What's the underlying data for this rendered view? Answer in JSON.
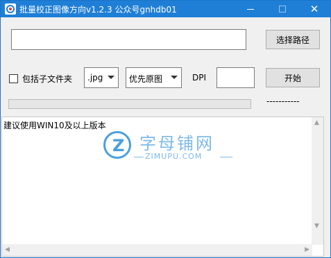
{
  "window": {
    "title": "批量校正图像方向v1.2.3 公众号gnhdb01",
    "icon": "app-icon",
    "controls": {
      "minimize": "minimize-icon",
      "maximize": "maximize-icon",
      "close": "✕"
    }
  },
  "path": {
    "value": "",
    "placeholder": ""
  },
  "buttons": {
    "select_path": "选择路径",
    "start": "开始"
  },
  "options": {
    "include_subfolders_label": "包括子文件夹",
    "include_subfolders_checked": false,
    "extension": ".jpg",
    "mode": "优先原图",
    "dpi_label": "DPI",
    "dpi_value": ""
  },
  "progress": {
    "percent": 0,
    "status": "-----------"
  },
  "log": {
    "text": "建议使用WIN10及以上版本"
  },
  "watermark": {
    "chinese": "字母铺网",
    "url": "ZIMUPU.COM",
    "logo_letter": "Z"
  },
  "colors": {
    "titlebar": "#1f7fd6",
    "progress_fill": "#06b025",
    "watermark": "#4a9fe0"
  }
}
